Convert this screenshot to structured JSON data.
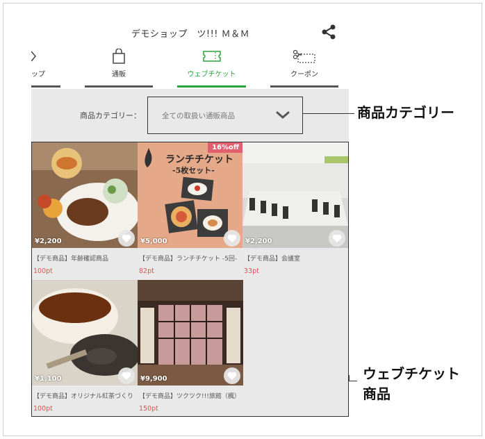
{
  "header": {
    "shop_name": "デモショップ　ツ!!! Ｍ＆Ｍ",
    "share_icon": "share-icon"
  },
  "tabs": [
    {
      "label": "ップ",
      "icon": "tag-icon",
      "active": false
    },
    {
      "label": "通販",
      "icon": "shopping-bag-icon",
      "active": false
    },
    {
      "label": "ウェブチケット",
      "icon": "ticket-icon",
      "active": true
    },
    {
      "label": "クーポン",
      "icon": "coupon-scissors-icon",
      "active": false
    }
  ],
  "category": {
    "label": "商品カテゴリー：",
    "selected": "全ての取扱い通販商品"
  },
  "annotations": {
    "category": "商品カテゴリー",
    "products_line1": "ウェブチケット",
    "products_line2": "商品"
  },
  "products": [
    {
      "price": "¥2,200",
      "name": "【デモ商品】年齢確認商品",
      "points": "100pt"
    },
    {
      "price": "¥5,000",
      "name": "【デモ商品】ランチチケット -5回-",
      "points": "82pt",
      "badge": "16%off",
      "ticket_title": "ランチチケット",
      "ticket_sub": "-5枚セット-"
    },
    {
      "price": "¥2,200",
      "name": "【デモ商品】会議室",
      "points": "33pt"
    },
    {
      "price": "¥1,100",
      "name": "【デモ商品】オリジナル紅茶づくり",
      "points": "100pt"
    },
    {
      "price": "¥9,900",
      "name": "【デモ商品】ツクツク!!!旅館（楓）",
      "points": "150pt"
    }
  ],
  "colors": {
    "accent": "#2aa33a",
    "points": "#e05050",
    "badge": "#e06070"
  }
}
